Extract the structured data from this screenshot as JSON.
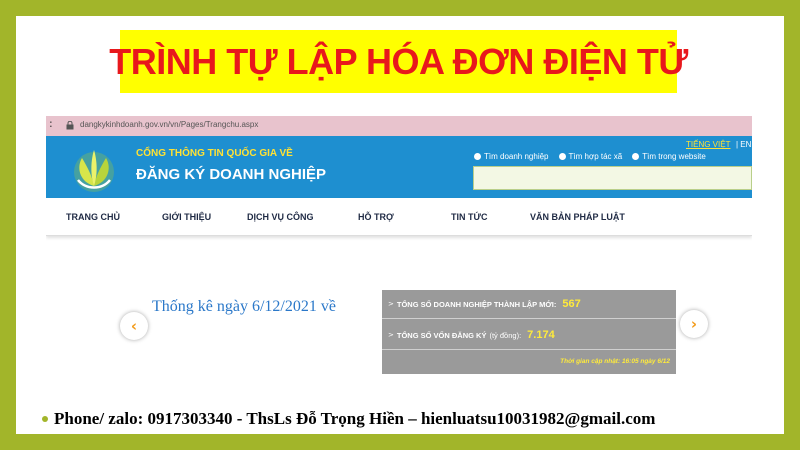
{
  "slide": {
    "title": "TRÌNH TỰ LẬP HÓA ĐƠN ĐIỆN TỬ",
    "contact": "Phone/ zalo: 0917303340 - ThsLs Đỗ Trọng Hiền – hienluatsu10031982@gmail.com"
  },
  "browser": {
    "url": "dangkykinhdoanh.gov.vn/vn/Pages/Trangchu.aspx"
  },
  "header": {
    "portal_line1": "CỔNG THÔNG TIN QUỐC GIA VỀ",
    "portal_line2": "ĐĂNG KÝ DOANH NGHIỆP",
    "language": "TIẾNG VIỆT",
    "language_sep": "| EN",
    "search_options": [
      "Tìm doanh nghiệp",
      "Tìm hợp tác xã",
      "Tìm trong website"
    ]
  },
  "nav": {
    "items": [
      "TRANG CHỦ",
      "GIỚI THIỆU",
      "DỊCH VỤ CÔNG",
      "HỖ TRỢ",
      "TIN TỨC",
      "VĂN BẢN PHÁP LUẬT"
    ]
  },
  "stats": {
    "intro": "Thống kê ngày 6/12/2021 về",
    "row1_label": "TỔNG SỐ DOANH NGHIỆP THÀNH LẬP MỚI:",
    "row1_value": "567",
    "row2_label": "TỔNG SỐ VỐN ĐĂNG KÝ",
    "row2_unit": "(tỷ đồng):",
    "row2_value": "7.174",
    "updated": "Thời gian cập nhật: 16:05 ngày 6/12"
  },
  "icons": {
    "prev": "chevron-left-icon",
    "next": "chevron-right-icon",
    "lock": "lock-icon",
    "logo": "leaf-logo"
  },
  "colors": {
    "frame": "#a2b52a",
    "title_bg": "#ffff00",
    "title_text": "#e8181c",
    "header_blue": "#1e8fd0",
    "stat_value": "#ffeb3b"
  }
}
